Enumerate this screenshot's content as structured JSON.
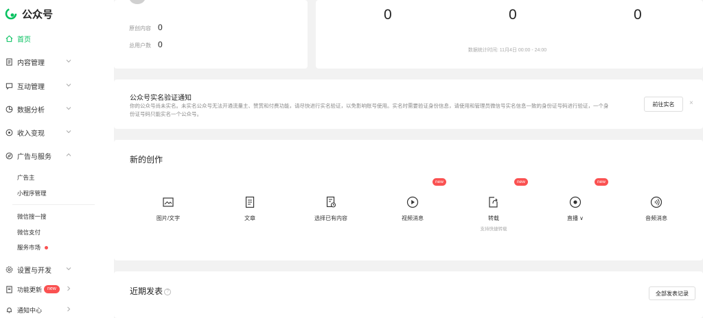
{
  "app": {
    "title": "公众号",
    "brand_color": "#07c160"
  },
  "sidebar": {
    "home": "首页",
    "content": "内容管理",
    "interact": "互动管理",
    "analytics": "数据分析",
    "revenue": "收入变现",
    "ads": "广告与服务",
    "sub_items": [
      "广告主",
      "小程序管理",
      "微信搜一搜",
      "微信支付",
      "服务市场"
    ],
    "settings": "设置与开发",
    "updates": "功能更新",
    "updates_badge": "new",
    "notify": "通知中心"
  },
  "stats": {
    "original_label": "原创内容",
    "original_value": "0",
    "users_label": "总用户数",
    "users_value": "0",
    "numbers": [
      "0",
      "0",
      "0"
    ],
    "time_note": "数据统计时间: 11月4日 00:00 - 24:00"
  },
  "notice": {
    "title": "公众号实名验证通知",
    "text": "你的公众号尚未实名。未实名公众号无法开通流量主、赞赏和付费功能，请尽快进行实名验证，以免影响账号使用。实名时需要验证身份信息，请使用和管理员微信号实名信息一致的身份证号码进行验证，一个身份证号码只能实名一个公众号。",
    "button": "前往实名",
    "close": "×"
  },
  "create": {
    "title": "新的创作",
    "items": [
      {
        "label": "图片/文字",
        "icon": "image-icon"
      },
      {
        "label": "文章",
        "icon": "article-icon"
      },
      {
        "label": "选择已有内容",
        "icon": "existing-content-icon"
      },
      {
        "label": "视频消息",
        "icon": "video-icon"
      },
      {
        "label": "转载",
        "icon": "repost-icon",
        "sub": "支持快捷转载"
      },
      {
        "label": "直播 ∨",
        "icon": "live-icon"
      },
      {
        "label": "音频消息",
        "icon": "audio-icon"
      }
    ],
    "new_badge": "new"
  },
  "recent": {
    "title": "近期发表",
    "help": "?",
    "all_button": "全部发表记录"
  }
}
